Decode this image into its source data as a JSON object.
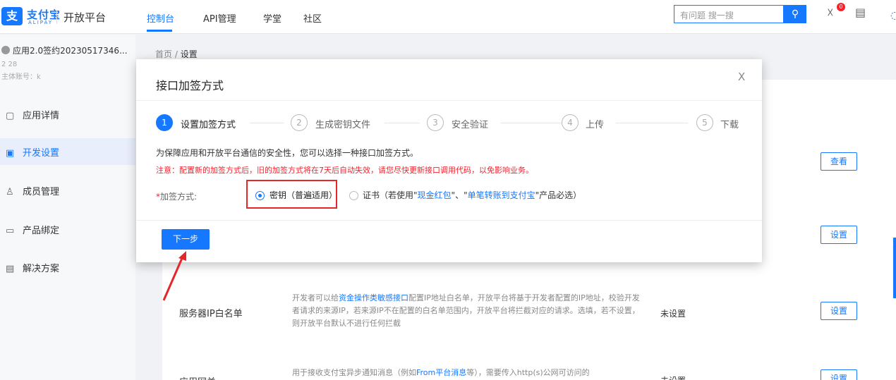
{
  "header": {
    "logo_mark": "支",
    "brand_cn": "支付宝",
    "brand_en": "ALIPAY",
    "platform": "开放平台",
    "nav": [
      {
        "label": "控制台"
      },
      {
        "label": "API管理"
      },
      {
        "label": "学堂"
      },
      {
        "label": "社区"
      }
    ],
    "search_placeholder": "有问题 搜一搜",
    "search_icon": "search-icon",
    "bell_icon": "bell-icon",
    "notification_count": "0",
    "doc_icon": "file-icon"
  },
  "sidebar": {
    "app_name": "应用2.0签约20230517346...",
    "app_id": "2          28",
    "app_sub": "主体账号：k",
    "items": [
      {
        "icon": "▢",
        "label": "应用详情"
      },
      {
        "icon": "▣",
        "label": "开发设置"
      },
      {
        "icon": "♙",
        "label": "成员管理"
      },
      {
        "icon": "▭",
        "label": "产品绑定"
      },
      {
        "icon": "▤",
        "label": "解决方案"
      }
    ]
  },
  "breadcrumb": {
    "home": "首页",
    "sep": "/",
    "current": "设置"
  },
  "rows": [
    {
      "button": "查看"
    },
    {
      "button": "设置"
    },
    {
      "title": "服务器IP白名单",
      "desc_prefix": "开发者可以给",
      "desc_link": "资金操作类敏感接口",
      "desc_suffix": "配置IP地址白名单，开放平台将基于开发者配置的IP地址，校验开发者请求的来源IP，若来源IP不在配置的白名单范围内，开放平台将拦截对应的请求。选填，若不设置，则开放平台默认不进行任何拦截",
      "status": "未设置",
      "button": "设置"
    },
    {
      "title": "应用网关",
      "desc_prefix": "用于接收支付宝异步通知消息（例如",
      "desc_link": "From平台消息",
      "desc_suffix": "等），需要传入http(s)公网可访问的",
      "status": "未设置",
      "button": "设置"
    }
  ],
  "modal": {
    "title": "接口加签方式",
    "close": "X",
    "steps": [
      {
        "num": "1",
        "label": "设置加签方式"
      },
      {
        "num": "2",
        "label": "生成密钥文件"
      },
      {
        "num": "3",
        "label": "安全验证"
      },
      {
        "num": "4",
        "label": "上传"
      },
      {
        "num": "5",
        "label": "下载"
      }
    ],
    "info": "为保障应用和开放平台通信的安全性，您可以选择一种接口加签方式。",
    "warning": "注意：配置新的加签方式后，旧的加签方式将在7天后自动失效，请您尽快更新接口调用代码，以免影响业务。",
    "field_star": "*",
    "field_label": "加签方式:",
    "option1": "密钥（普遍适用）",
    "option2_prefix": "证书（若使用\"",
    "option2_link1": "现金红包",
    "option2_mid": "\"、\"",
    "option2_link2": "单笔转账到支付宝",
    "option2_suffix": "\"产品必选）",
    "next_button": "下一步"
  },
  "colors": {
    "brand": "#1677ff",
    "warning": "#f5222d",
    "highlight": "#e5262a"
  }
}
